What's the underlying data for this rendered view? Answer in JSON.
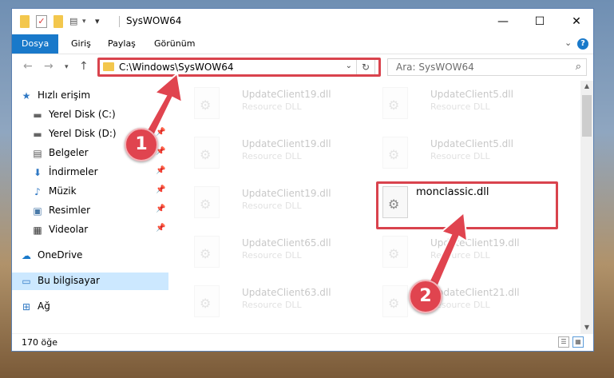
{
  "window": {
    "title": "SysWOW64",
    "controls": {
      "minimize": "—",
      "maximize": "☐",
      "close": "✕"
    }
  },
  "ribbon": {
    "tabs": [
      "Dosya",
      "Giriş",
      "Paylaş",
      "Görünüm"
    ],
    "active_tab": "Dosya",
    "accent_color": "#1979ca"
  },
  "address_bar": {
    "path": "C:\\Windows\\SysWOW64",
    "refresh_icon": "refresh-icon"
  },
  "search": {
    "placeholder": "Ara: SysWOW64"
  },
  "nav_pane": {
    "items": [
      {
        "label": "Hızlı erişim",
        "icon": "star-icon",
        "pinned": false
      },
      {
        "label": "Yerel Disk (C:)",
        "icon": "drive-icon",
        "pinned": true
      },
      {
        "label": "Yerel Disk (D:)",
        "icon": "drive-icon",
        "pinned": true
      },
      {
        "label": "Belgeler",
        "icon": "documents-icon",
        "pinned": true
      },
      {
        "label": "İndirmeler",
        "icon": "downloads-icon",
        "pinned": true
      },
      {
        "label": "Müzik",
        "icon": "music-icon",
        "pinned": true
      },
      {
        "label": "Resimler",
        "icon": "pictures-icon",
        "pinned": true
      },
      {
        "label": "Videolar",
        "icon": "videos-icon",
        "pinned": true
      },
      {
        "label": "OneDrive",
        "icon": "cloud-icon",
        "pinned": false
      },
      {
        "label": "Bu bilgisayar",
        "icon": "computer-icon",
        "pinned": false,
        "selected": true
      },
      {
        "label": "Ağ",
        "icon": "network-icon",
        "pinned": false
      }
    ]
  },
  "files": [
    {
      "name": "UpdateClient19.dll",
      "type": "Resource DLL",
      "faded": true
    },
    {
      "name": "UpdateClient5.dll",
      "type": "Resource DLL",
      "faded": true
    },
    {
      "name": "UpdateClient19.dll",
      "type": "Resource DLL",
      "faded": true
    },
    {
      "name": "UpdateClient5.dll",
      "type": "Resource DLL",
      "faded": true
    },
    {
      "name": "UpdateClient19.dll",
      "type": "Resource DLL",
      "faded": true
    },
    {
      "name": "monclassic.dll",
      "type": "",
      "faded": false,
      "highlighted": true
    },
    {
      "name": "UpdateClient65.dll",
      "type": "Resource DLL",
      "faded": true
    },
    {
      "name": "UpdateClient19.dll",
      "type": "Resource DLL",
      "faded": true
    },
    {
      "name": "UpdateClient63.dll",
      "type": "Resource DLL",
      "faded": true
    },
    {
      "name": "UpdateClient21.dll",
      "type": "Resource DLL",
      "faded": true
    }
  ],
  "status_bar": {
    "item_count": "170 öğe"
  },
  "annotations": {
    "step1": "1",
    "step2": "2",
    "highlight_color": "#d9434d"
  }
}
